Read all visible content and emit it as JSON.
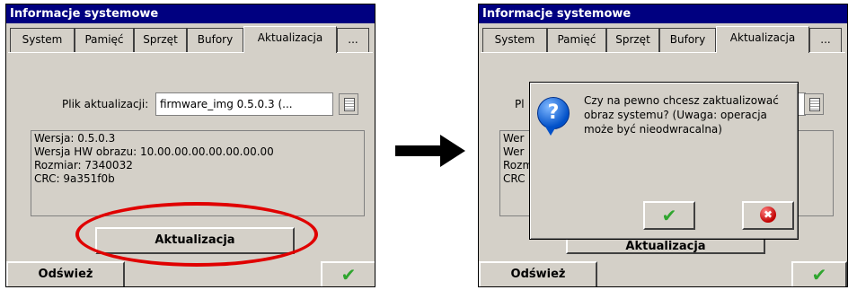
{
  "left": {
    "title": "Informacje systemowe",
    "tabs": [
      "System",
      "Pamięć",
      "Sprzęt",
      "Bufory",
      "Aktualizacja",
      "..."
    ],
    "active_tab": "Aktualizacja",
    "file_label": "Plik aktualizacji:",
    "file_value": "firmware_img 0.5.0.3 (...",
    "info_lines": [
      "Wersja: 0.5.0.3",
      "Wersja HW obrazu: 10.00.00.00.00.00.00.00",
      "Rozmiar: 7340032",
      "CRC: 9a351f0b"
    ],
    "update_button": "Aktualizacja",
    "refresh_button": "Odśwież",
    "ok_symbol": "✔"
  },
  "right": {
    "title": "Informacje systemowe",
    "tabs": [
      "System",
      "Pamięć",
      "Sprzęt",
      "Bufory",
      "Aktualizacja",
      "..."
    ],
    "active_tab": "Aktualizacja",
    "file_label_visible": "Pl",
    "info_visible": [
      "Wer",
      "Wer",
      "Rozm",
      "CRC"
    ],
    "update_button": "Aktualizacja",
    "refresh_button": "Odśwież",
    "ok_symbol": "✔",
    "dialog": {
      "text": "Czy na pewno chcesz zaktualizować obraz systemu? (Uwaga: operacja może być nieodwracalna)",
      "yes_symbol": "✔",
      "no_symbol": "✖"
    }
  },
  "colors": {
    "titlebar": "#000080",
    "window": "#d4d0c8",
    "highlight": "#e00000",
    "check": "#2fa52f"
  }
}
